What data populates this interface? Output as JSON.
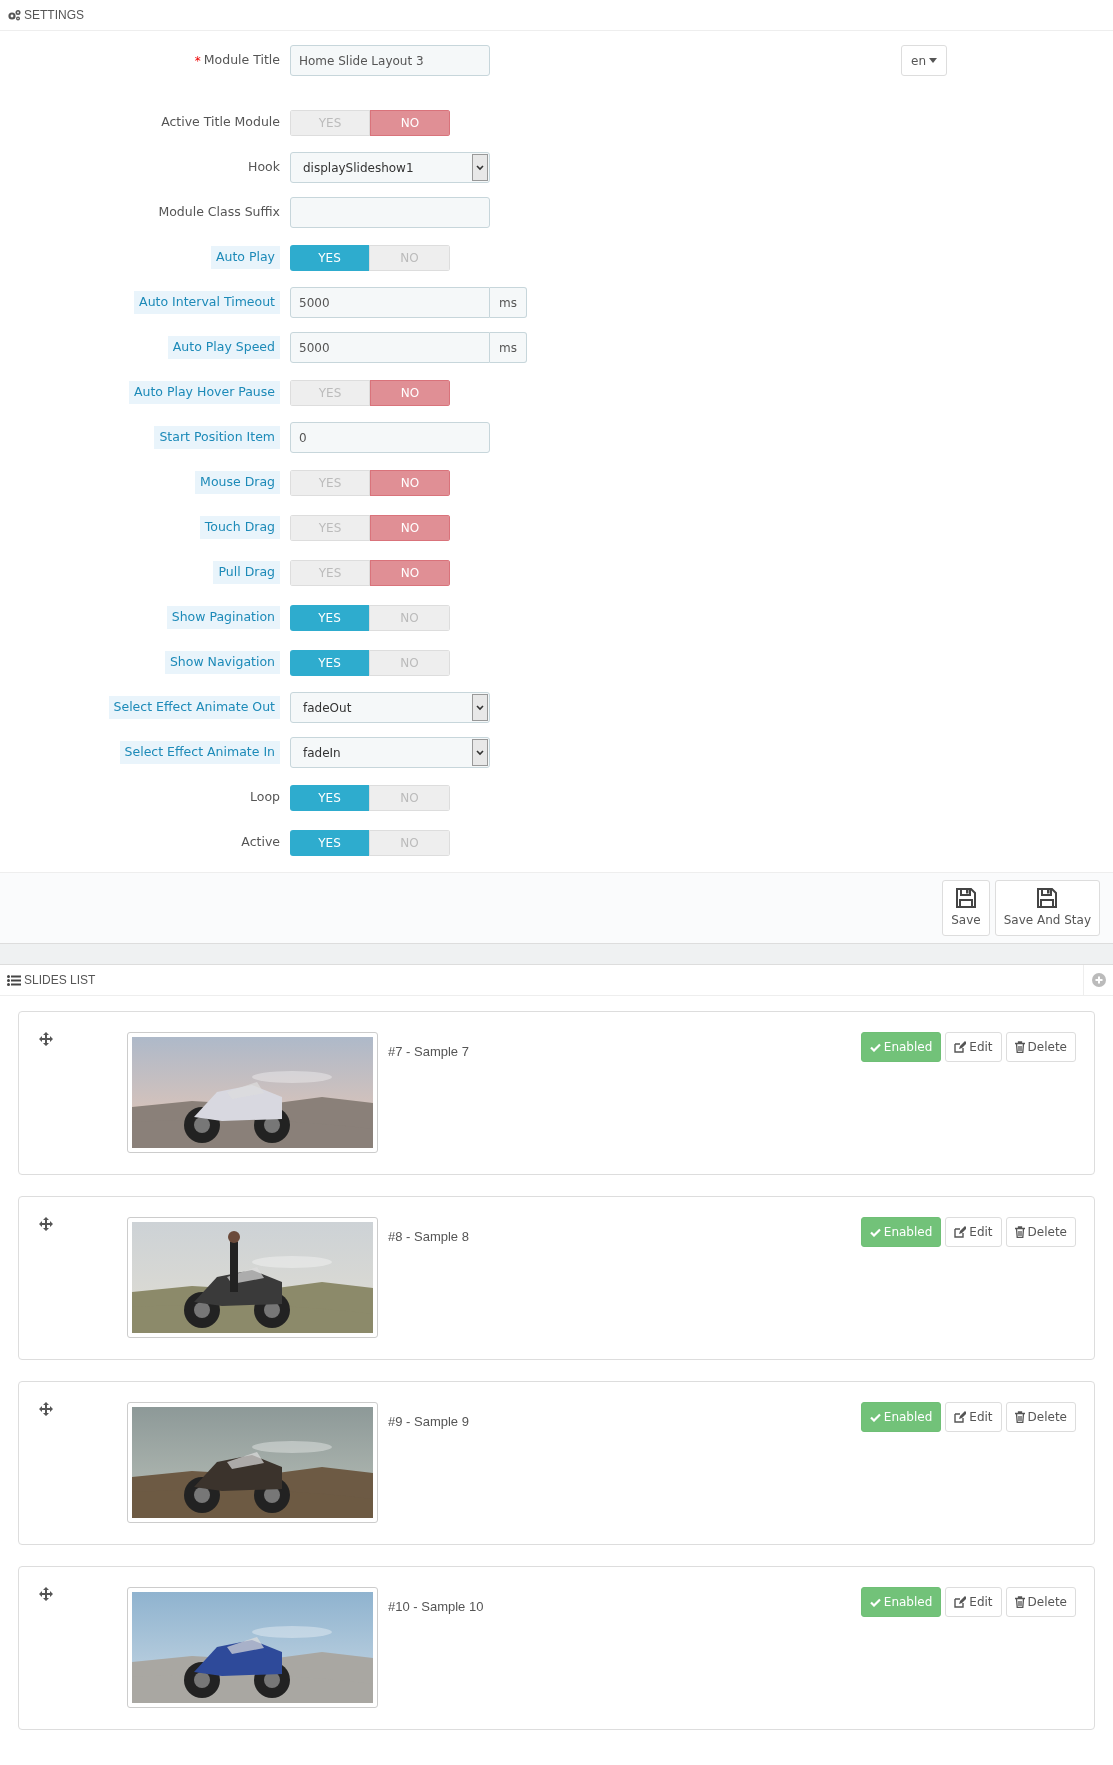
{
  "panel": {
    "title": "SETTINGS"
  },
  "language": "en",
  "fields": [
    {
      "kind": "text",
      "label": "Module Title",
      "required_mark": "*",
      "help": false,
      "value": "Home Slide Layout 3"
    },
    {
      "kind": "toggle",
      "label": "Active Title Module",
      "help": false,
      "on": false,
      "yes": "YES",
      "no": "NO"
    },
    {
      "kind": "select",
      "label": "Hook",
      "help": false,
      "value": "displaySlideshow1"
    },
    {
      "kind": "text",
      "label": "Module Class Suffix",
      "help": false
    },
    {
      "kind": "toggle",
      "label": "Auto Play",
      "help": true,
      "on": true,
      "yes": "YES",
      "no": "NO"
    },
    {
      "kind": "addon",
      "label": "Auto Interval Timeout",
      "help": true,
      "value": "5000",
      "suffix": "ms"
    },
    {
      "kind": "addon",
      "label": "Auto Play Speed",
      "help": true,
      "value": "5000",
      "suffix": "ms"
    },
    {
      "kind": "toggle",
      "label": "Auto Play Hover Pause",
      "help": true,
      "on": false,
      "yes": "YES",
      "no": "NO"
    },
    {
      "kind": "text",
      "label": "Start Position Item",
      "help": true,
      "value": "0"
    },
    {
      "kind": "toggle",
      "label": "Mouse Drag",
      "help": true,
      "on": false,
      "yes": "YES",
      "no": "NO"
    },
    {
      "kind": "toggle",
      "label": "Touch Drag",
      "help": true,
      "on": false,
      "yes": "YES",
      "no": "NO"
    },
    {
      "kind": "toggle",
      "label": "Pull Drag",
      "help": true,
      "on": false,
      "yes": "YES",
      "no": "NO"
    },
    {
      "kind": "toggle",
      "label": "Show Pagination",
      "help": true,
      "on": true,
      "yes": "YES",
      "no": "NO"
    },
    {
      "kind": "toggle",
      "label": "Show Navigation",
      "help": true,
      "on": true,
      "yes": "YES",
      "no": "NO"
    },
    {
      "kind": "select",
      "label": "Select Effect Animate Out",
      "help": true,
      "value": "fadeOut"
    },
    {
      "kind": "select",
      "label": "Select Effect Animate In",
      "help": true,
      "value": "fadeIn"
    },
    {
      "kind": "toggle",
      "label": "Loop",
      "help": false,
      "on": true,
      "yes": "YES",
      "no": "NO"
    },
    {
      "kind": "toggle",
      "label": "Active",
      "help": false,
      "on": true,
      "yes": "YES",
      "no": "NO"
    }
  ],
  "buttons": [
    {
      "label": "Save"
    },
    {
      "label": "Save And Stay"
    }
  ],
  "slides_panel": {
    "title": "SLIDES LIST"
  },
  "slides": [
    {
      "title": "#7 - Sample 7",
      "status": "Enabled",
      "enabled": true,
      "edit": "Edit",
      "delete": "Delete"
    },
    {
      "title": "#8 - Sample 8",
      "status": "Enabled",
      "enabled": true,
      "edit": "Edit",
      "delete": "Delete"
    },
    {
      "title": "#9 - Sample 9",
      "status": "Enabled",
      "enabled": true,
      "edit": "Edit",
      "delete": "Delete"
    },
    {
      "title": "#10 - Sample 10",
      "status": "Enabled",
      "enabled": true,
      "edit": "Edit",
      "delete": "Delete"
    }
  ]
}
